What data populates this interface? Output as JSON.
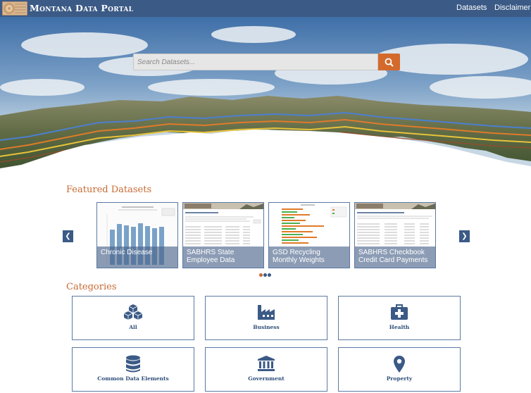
{
  "header": {
    "brand": "Montana Data Portal",
    "nav": [
      {
        "label": "Datasets"
      },
      {
        "label": "Disclaimer"
      }
    ]
  },
  "search": {
    "placeholder": "Search Datasets..."
  },
  "featured": {
    "title": "Featured Datasets",
    "cards": [
      {
        "label": "Chronic Disease"
      },
      {
        "label": "SABHRS State Employee Data"
      },
      {
        "label": "GSD Recycling Monthly Weights"
      },
      {
        "label": "SABHRS Checkbook Credit Card Payments"
      }
    ],
    "active_dot": 0,
    "dot_count": 3
  },
  "categories": {
    "title": "Categories",
    "items": [
      {
        "label": "All",
        "icon": "cubes-icon"
      },
      {
        "label": "Business",
        "icon": "factory-icon"
      },
      {
        "label": "Health",
        "icon": "medical-kit-icon"
      },
      {
        "label": "Common Data Elements",
        "icon": "database-icon"
      },
      {
        "label": "Government",
        "icon": "government-building-icon"
      },
      {
        "label": "Property",
        "icon": "map-marker-icon"
      }
    ]
  },
  "colors": {
    "primary": "#3b5a86",
    "accent": "#c86a33",
    "search_button": "#d36a2c"
  }
}
